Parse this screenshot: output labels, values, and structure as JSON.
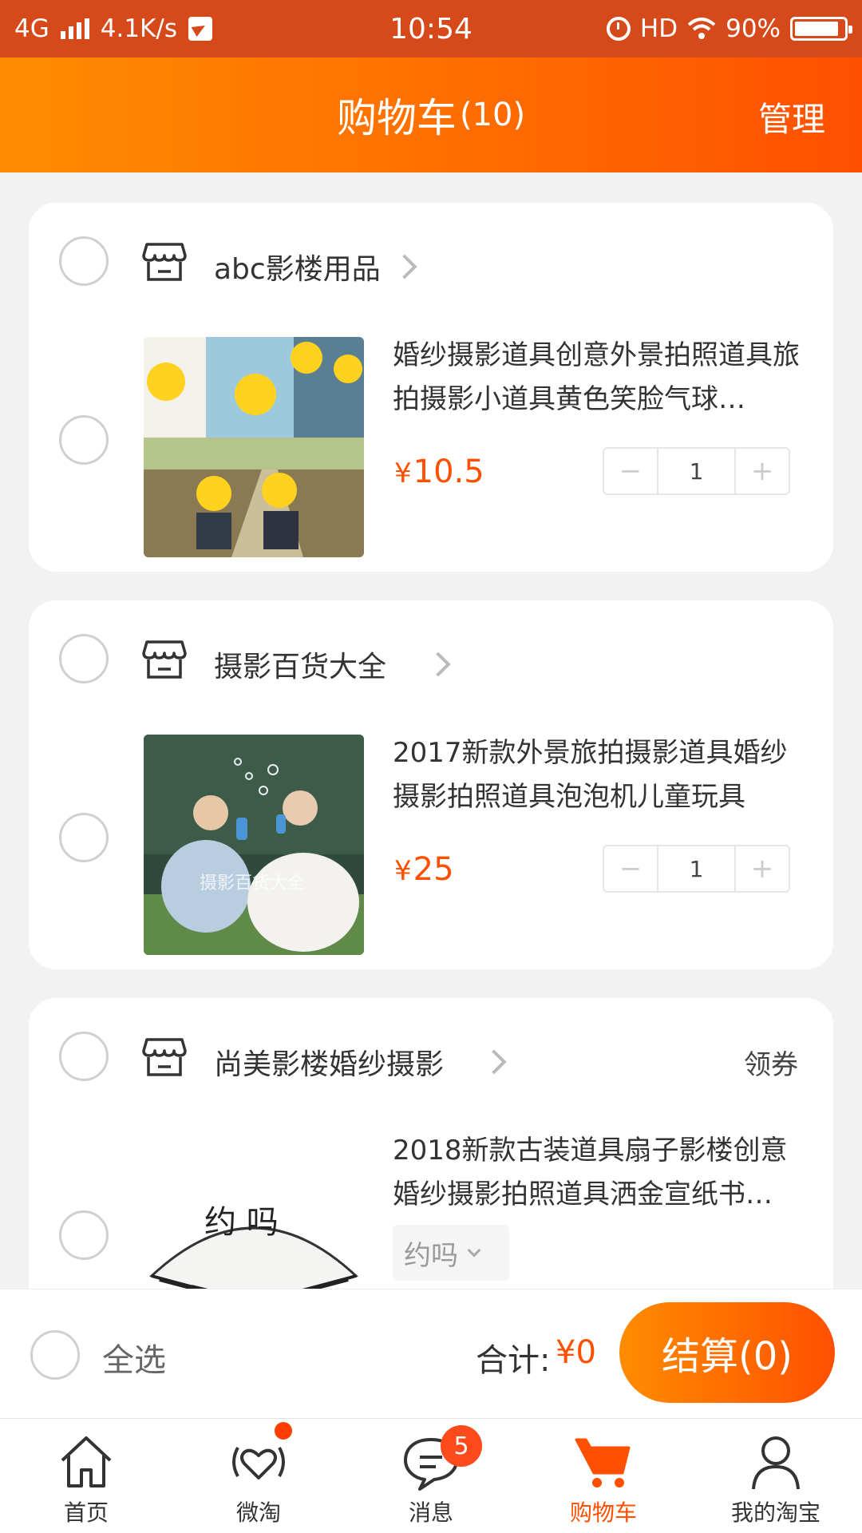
{
  "status_bar": {
    "network": "4G",
    "speed": "4.1K/s",
    "time": "10:54",
    "hd": "HD",
    "battery": "90%",
    "battery_level": 0.9
  },
  "header": {
    "title": "购物车",
    "count": "(10)",
    "manage": "管理"
  },
  "shops": [
    {
      "name": "abc影楼用品",
      "coupon": "",
      "item": {
        "title": "婚纱摄影道具创意外景拍照道具旅拍摄影小道具黄色笑脸气球…",
        "yen": "¥",
        "price": "10.5",
        "quantity": "1"
      }
    },
    {
      "name": "摄影百货大全",
      "coupon": "",
      "item": {
        "title": "2017新款外景旅拍摄影道具婚纱摄影拍照道具泡泡机儿童玩具",
        "yen": "¥",
        "price": "25",
        "quantity": "1",
        "watermark": "摄影百货大全"
      }
    },
    {
      "name": "尚美影楼婚纱摄影",
      "coupon": "领券",
      "item": {
        "title": "2018新款古装道具扇子影楼创意婚纱摄影拍照道具洒金宣纸书…",
        "sku": "约吗",
        "fan_text": "约 吗"
      }
    }
  ],
  "checkout": {
    "select_all": "全选",
    "total_label": "合计:",
    "total_value": "¥0",
    "button": "结算(0)"
  },
  "tabs": [
    {
      "label": "首页",
      "icon": "home-icon"
    },
    {
      "label": "微淘",
      "icon": "weitao-icon"
    },
    {
      "label": "消息",
      "icon": "message-icon",
      "badge": "5"
    },
    {
      "label": "购物车",
      "icon": "cart-icon",
      "active": true
    },
    {
      "label": "我的淘宝",
      "icon": "user-icon"
    }
  ],
  "colors": {
    "accent": "#ff5000",
    "status_bar": "#d6491a",
    "header_start": "#ff8c00",
    "header_end": "#ff5000"
  }
}
